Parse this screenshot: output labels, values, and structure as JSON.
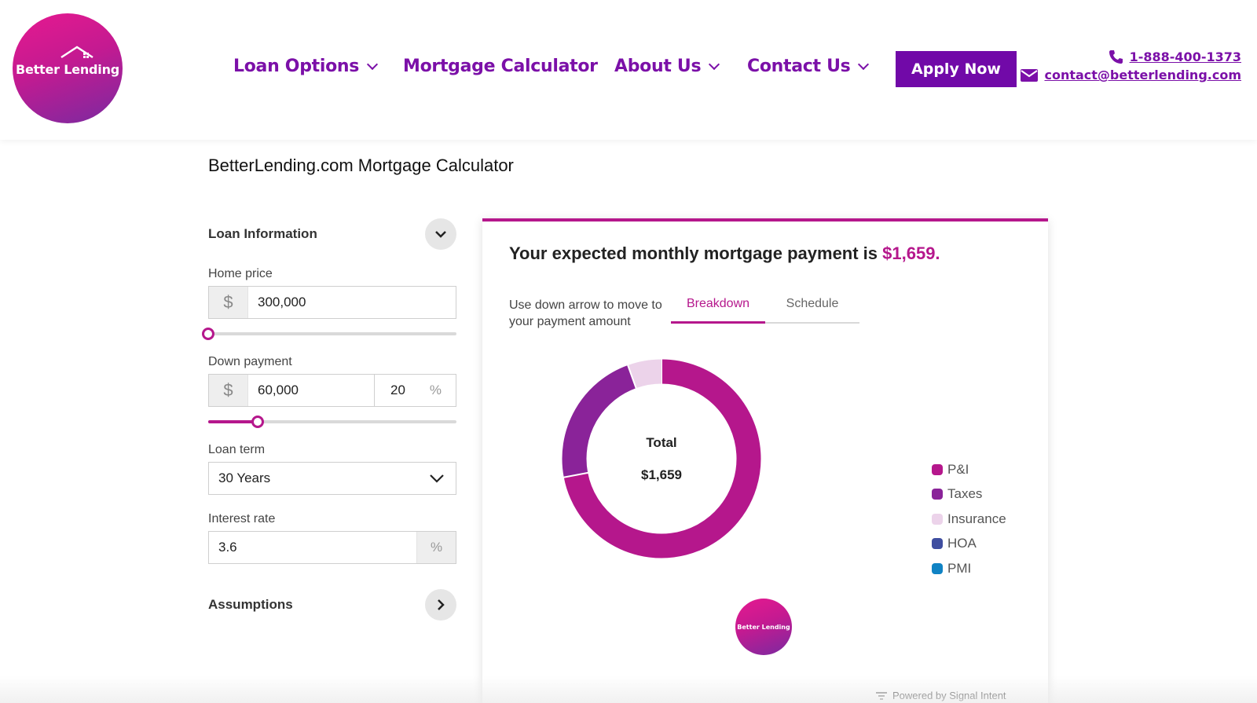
{
  "brand": {
    "logo_text": "Better Lending",
    "primary_color": "#7b10a8",
    "accent_color": "#b5178c"
  },
  "nav": {
    "items": [
      {
        "label": "Loan Options",
        "has_dropdown": true
      },
      {
        "label": "Mortgage Calculator",
        "has_dropdown": false
      },
      {
        "label": "About Us",
        "has_dropdown": true
      },
      {
        "label": "Contact Us",
        "has_dropdown": true
      }
    ],
    "apply_label": "Apply Now"
  },
  "contact": {
    "phone": "1-888-400-1373",
    "email": "contact@betterlending.com"
  },
  "calculator": {
    "title": "BetterLending.com Mortgage Calculator",
    "loan_info_label": "Loan Information",
    "home_price": {
      "label": "Home price",
      "prefix": "$",
      "value": "300,000",
      "slider_fraction": 0.0
    },
    "down_payment": {
      "label": "Down payment",
      "prefix": "$",
      "value": "60,000",
      "percent": "20",
      "percent_symbol": "%",
      "slider_fraction": 0.2
    },
    "loan_term": {
      "label": "Loan term",
      "value": "30 Years"
    },
    "interest_rate": {
      "label": "Interest rate",
      "value": "3.6",
      "suffix": "%"
    },
    "assumptions_label": "Assumptions"
  },
  "result": {
    "headline_prefix": "Your expected monthly mortgage payment is ",
    "headline_amount": "$1,659.",
    "hint": "Use down arrow to move to your payment amount",
    "tabs": [
      {
        "label": "Breakdown",
        "active": true
      },
      {
        "label": "Schedule",
        "active": false
      }
    ],
    "total_label": "Total",
    "total_value": "$1,659",
    "mini_logo_text": "Better Lending",
    "powered_by": "Powered by Signal Intent"
  },
  "chart_data": {
    "type": "pie",
    "donut": true,
    "series": [
      {
        "name": "P&I",
        "value": 0.72,
        "color": "#b5178c"
      },
      {
        "name": "Taxes",
        "value": 0.225,
        "color": "#8a2399"
      },
      {
        "name": "Insurance",
        "value": 0.055,
        "color": "#ecd3ea"
      },
      {
        "name": "HOA",
        "value": 0,
        "color": "#3f4ea0"
      },
      {
        "name": "PMI",
        "value": 0,
        "color": "#1083c4"
      }
    ]
  }
}
